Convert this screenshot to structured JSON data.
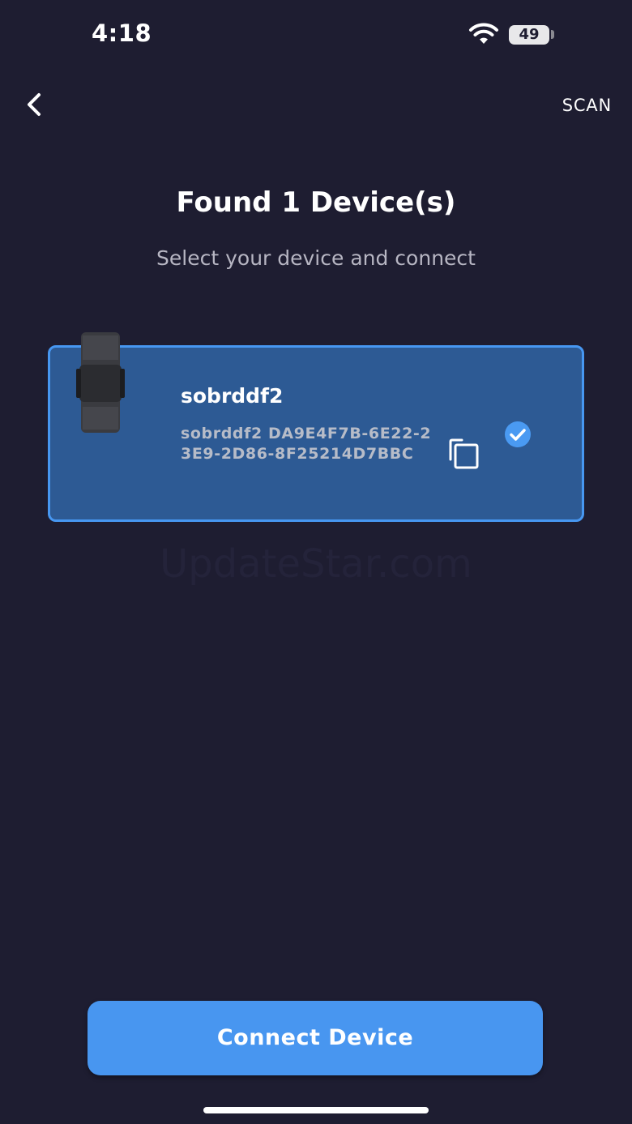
{
  "status_bar": {
    "time": "4:18",
    "battery_level": "49",
    "icons": [
      "wifi-icon",
      "battery-icon"
    ]
  },
  "nav": {
    "back_icon": "chevron-left-icon",
    "scan_label": "SCAN"
  },
  "header": {
    "title": "Found 1 Device(s)",
    "subtitle": "Select your device and connect"
  },
  "devices": [
    {
      "name": "sobrddf2",
      "identifier": "sobrddf2 DA9E4F7B-6E22-23E9-2D86-8F25214D7BBC",
      "selected": true,
      "image_icon": "wristband-device-image",
      "copy_icon": "copy-icon",
      "selected_icon": "check-circle-icon"
    }
  ],
  "watermark": "UpdateStar.com",
  "connect_button": {
    "label": "Connect Device"
  },
  "colors": {
    "background": "#1e1d31",
    "card_fill": "#2d5a94",
    "card_border": "#4797f1",
    "accent": "#4896f0"
  }
}
